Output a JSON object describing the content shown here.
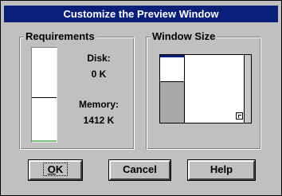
{
  "dialog": {
    "title": "Customize the Preview Window"
  },
  "requirements": {
    "label": "Requirements",
    "disk_label": "Disk:",
    "disk_value": "0 K",
    "memory_label": "Memory:",
    "memory_value": "1412 K"
  },
  "window_size": {
    "label": "Window Size"
  },
  "buttons": {
    "ok": "OK",
    "cancel": "Cancel",
    "help": "Help"
  }
}
